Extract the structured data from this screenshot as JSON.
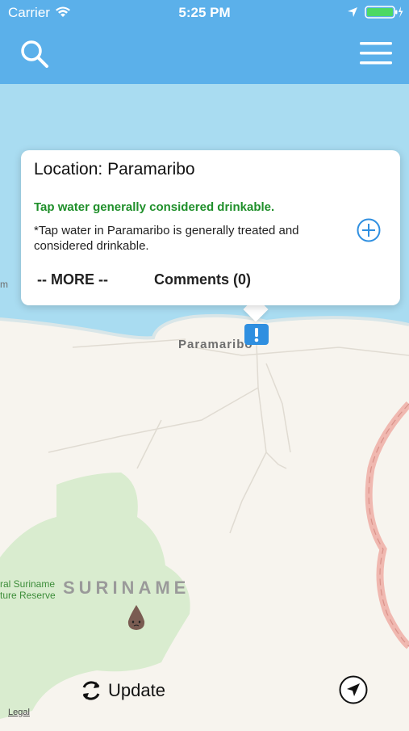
{
  "status_bar": {
    "carrier": "Carrier",
    "time": "5:25 PM"
  },
  "nav": {
    "search_icon": "search-icon",
    "menu_icon": "hamburger-menu-icon",
    "color": "#5bb0ea"
  },
  "popup": {
    "title": "Location: Paramaribo",
    "status": "Tap water generally considered drinkable.",
    "status_color": "#1f8f2a",
    "description": "*Tap water in Paramaribo is generally treated and considered drinkable.",
    "more_label": "-- MORE --",
    "comments_label": "Comments (0)",
    "add_icon": "plus-circle-icon"
  },
  "map": {
    "city_label": "Paramaribo",
    "country_label": "SURINAME",
    "reserve_label_line1": "ral Suriname",
    "reserve_label_line2": "ture Reserve",
    "left_edge_label": "m",
    "marker_icon": "exclamation-marker-icon"
  },
  "bottom": {
    "update_label": "Update",
    "legal_label": "Legal",
    "locate_icon": "location-arrow-icon"
  }
}
